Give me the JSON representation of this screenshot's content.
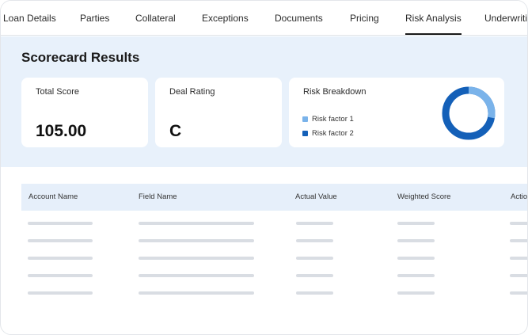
{
  "tabs": [
    {
      "label": "Loan Details",
      "active": false
    },
    {
      "label": "Parties",
      "active": false
    },
    {
      "label": "Collateral",
      "active": false
    },
    {
      "label": "Exceptions",
      "active": false
    },
    {
      "label": "Documents",
      "active": false
    },
    {
      "label": "Pricing",
      "active": false
    },
    {
      "label": "Risk Analysis",
      "active": true
    },
    {
      "label": "Underwriti",
      "active": false
    }
  ],
  "scorecard": {
    "title": "Scorecard Results",
    "total_score": {
      "label": "Total Score",
      "value": "105.00"
    },
    "deal_rating": {
      "label": "Deal Rating",
      "value": "C"
    },
    "risk_breakdown": {
      "label": "Risk Breakdown",
      "legend": [
        {
          "name": "Risk factor 1",
          "color": "#7ab3ea"
        },
        {
          "name": "Risk factor 2",
          "color": "#1460b8"
        }
      ],
      "donut_shares": [
        0.28,
        0.72
      ]
    }
  },
  "table": {
    "columns": [
      "Account Name",
      "Field Name",
      "Actual Value",
      "Weighted Score",
      "Actio"
    ],
    "placeholder_rows": 5
  },
  "colors": {
    "band_bg": "#e8f1fb",
    "header_bg": "#e6effa",
    "skeleton": "#d9dde3"
  }
}
